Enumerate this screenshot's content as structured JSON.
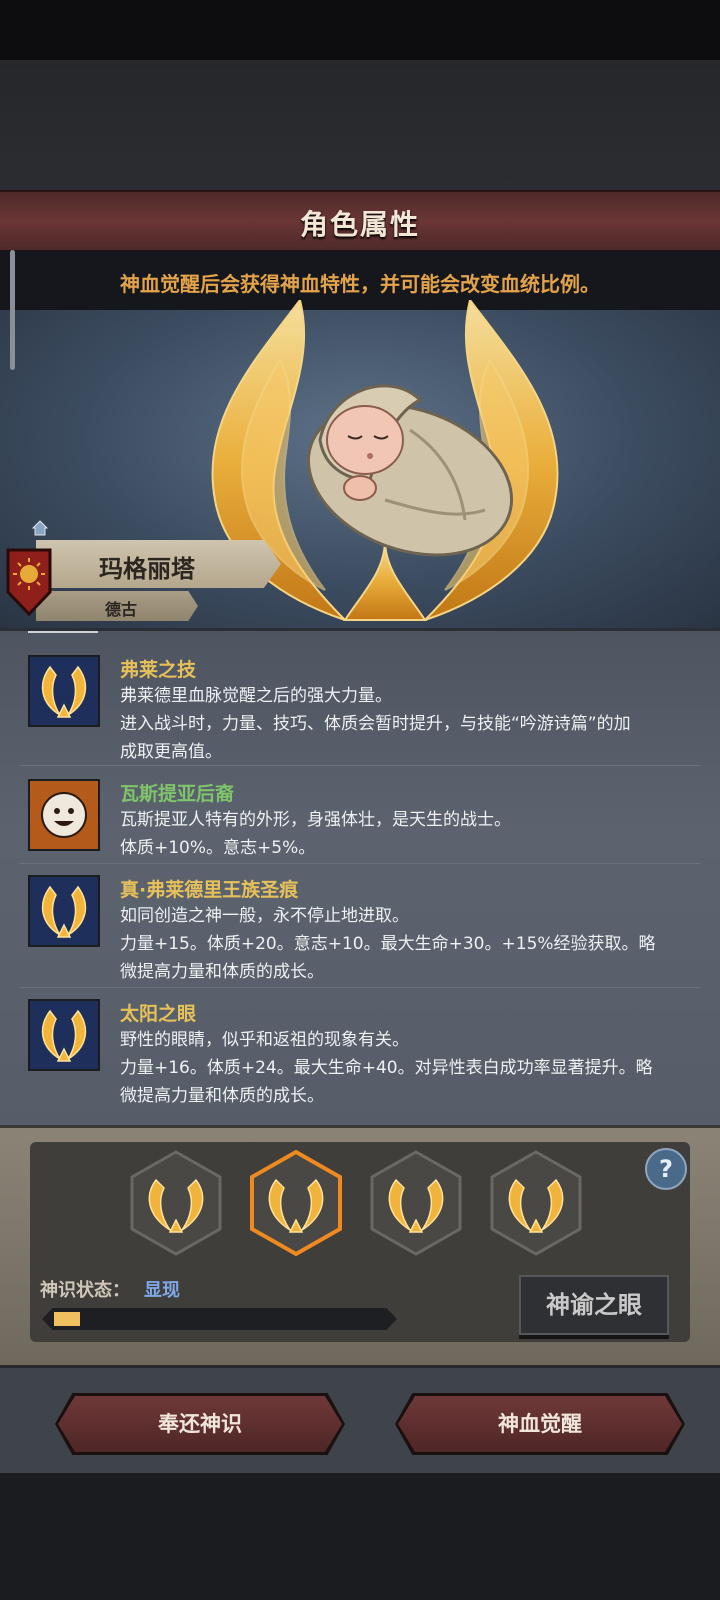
{
  "header": {
    "title": "角色属性"
  },
  "hint": {
    "text": "神血觉醒后会获得神血特性，并可能会改变血统比例。"
  },
  "character": {
    "name": "玛格丽塔",
    "lineage": "德古"
  },
  "traits": [
    {
      "icon": "flame-wreath-icon",
      "name": "弗莱之技",
      "name_color": "#e6c15a",
      "lines": [
        "弗莱德里血脉觉醒之后的强大力量。",
        "进入战斗时，力量、技巧、体质会暂时提升，与技能“吟游诗篇”的加",
        "成取更高值。"
      ]
    },
    {
      "icon": "smiley-face-icon",
      "name": "瓦斯提亚后裔",
      "name_color": "#7fc46b",
      "lines": [
        "瓦斯提亚人特有的外形，身强体壮，是天生的战士。",
        "体质+10%。意志+5%。"
      ]
    },
    {
      "icon": "flame-wreath-icon",
      "name": "真·弗莱德里王族圣痕",
      "name_color": "#e6c15a",
      "lines": [
        "如同创造之神一般，永不停止地进取。",
        "力量+15。体质+20。意志+10。最大生命+30。+15%经验获取。略",
        "微提高力量和体质的成长。"
      ]
    },
    {
      "icon": "flame-wreath-icon",
      "name": "太阳之眼",
      "name_color": "#e6c15a",
      "lines": [
        "野性的眼睛，似乎和返祖的现象有关。",
        "力量+16。体质+24。最大生命+40。对异性表白成功率显著提升。略",
        "微提高力量和体质的成长。"
      ]
    }
  ],
  "divinity": {
    "status_label": "神识状态：",
    "status_value": "显现",
    "progress": 0.08,
    "selected_slot": 2,
    "help": "?",
    "eye_button": "神谕之眼"
  },
  "footer": {
    "return_button": "奉还神识",
    "awaken_button": "神血觉醒"
  },
  "colors": {
    "accent_gold": "#f0b43c",
    "banner_red": "#6a3535",
    "hint_orange": "#e3a34b"
  }
}
